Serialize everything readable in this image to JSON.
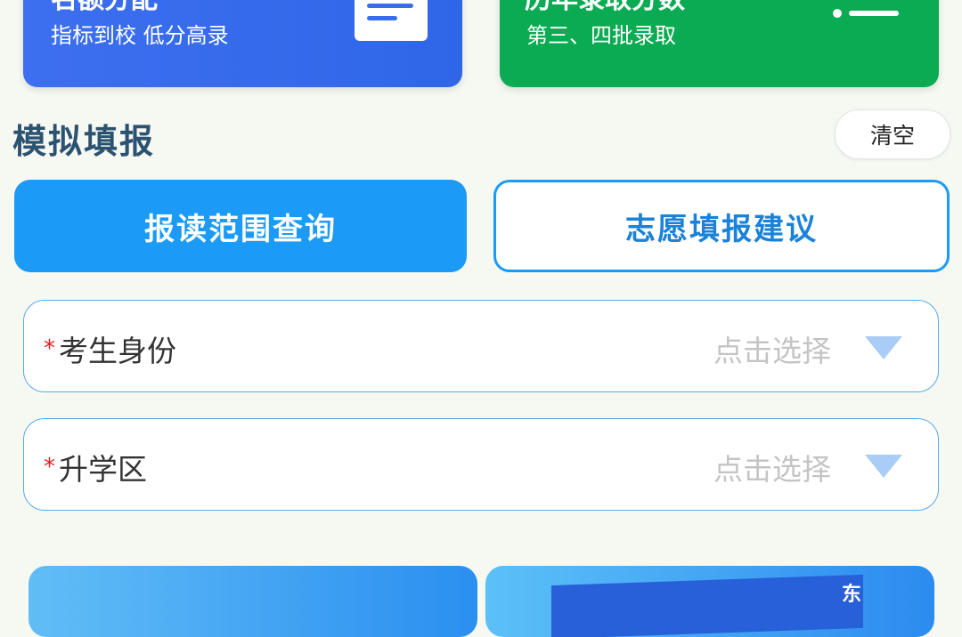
{
  "cards": [
    {
      "title": "名额分配",
      "subtitle": "指标到校 低分高录",
      "icon": "document-icon",
      "color": "#316aeb"
    },
    {
      "title": "历年录取分数",
      "subtitle": "第三、四批录取",
      "icon": "list-icon",
      "color": "#0aab52"
    }
  ],
  "section": {
    "title": "模拟填报",
    "clear_label": "清空"
  },
  "tabs": [
    {
      "label": "报读范围查询",
      "active": true
    },
    {
      "label": "志愿填报建议",
      "active": false
    }
  ],
  "fields": [
    {
      "required_mark": "*",
      "label": "考生身份",
      "placeholder": "点击选择"
    },
    {
      "required_mark": "*",
      "label": "升学区",
      "placeholder": "点击选择"
    }
  ],
  "bottom_cards": [
    {
      "text": ""
    },
    {
      "text": "东"
    }
  ],
  "colors": {
    "accent": "#1b9bf5",
    "required": "#e02020",
    "title": "#2b5270"
  }
}
